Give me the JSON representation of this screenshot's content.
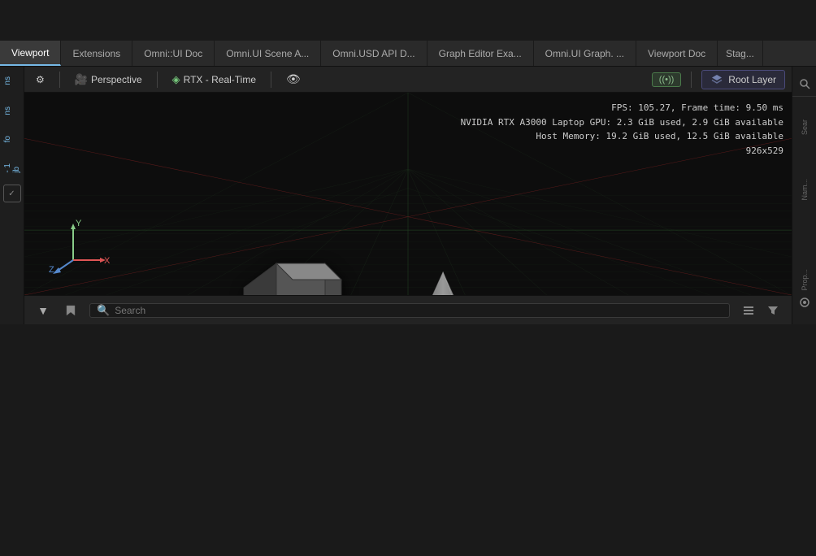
{
  "topbar": {
    "bg": "#252525"
  },
  "tabs": {
    "items": [
      {
        "label": "Viewport",
        "active": true
      },
      {
        "label": "Extensions",
        "active": false
      },
      {
        "label": "Omni::UI Doc",
        "active": false
      },
      {
        "label": "Omni.UI Scene A...",
        "active": false
      },
      {
        "label": "Omni.USD API D...",
        "active": false
      },
      {
        "label": "Graph Editor Exa...",
        "active": false
      },
      {
        "label": "Omni.UI Graph. ...",
        "active": false
      },
      {
        "label": "Viewport Doc",
        "active": false
      },
      {
        "label": "Stag...",
        "active": false
      }
    ]
  },
  "viewport": {
    "toolbar": {
      "settings_icon": "⚙",
      "camera_icon": "📷",
      "camera_label": "Perspective",
      "rtx_icon": "◈",
      "rtx_label": "RTX - Real-Time",
      "eye_icon": "👁",
      "streaming_label": "((•))",
      "root_layer_icon": "⬡",
      "root_layer_label": "Root Layer"
    },
    "stats": {
      "fps": "FPS: 105.27,  Frame time: 9.50 ms",
      "gpu": "NVIDIA RTX A3000 Laptop GPU: 2.3 GiB used,  2.9 GiB available",
      "memory": "Host Memory: 19.2 GiB used,  12.5 GiB available",
      "resolution": "926x529"
    }
  },
  "bottombar": {
    "filter_icon": "▼",
    "bookmark_icon": "🔖",
    "search_placeholder": "Search",
    "list_icon": "☰",
    "funnel_icon": "⛛"
  },
  "rightpanel": {
    "search_label": "Sear",
    "name_label": "Nam...",
    "prop_label": "Prop..."
  },
  "axis": {
    "x_color": "#e05555",
    "y_color": "#88cc88",
    "z_color": "#5588cc",
    "labels": [
      "X",
      "Y",
      "Z"
    ]
  }
}
